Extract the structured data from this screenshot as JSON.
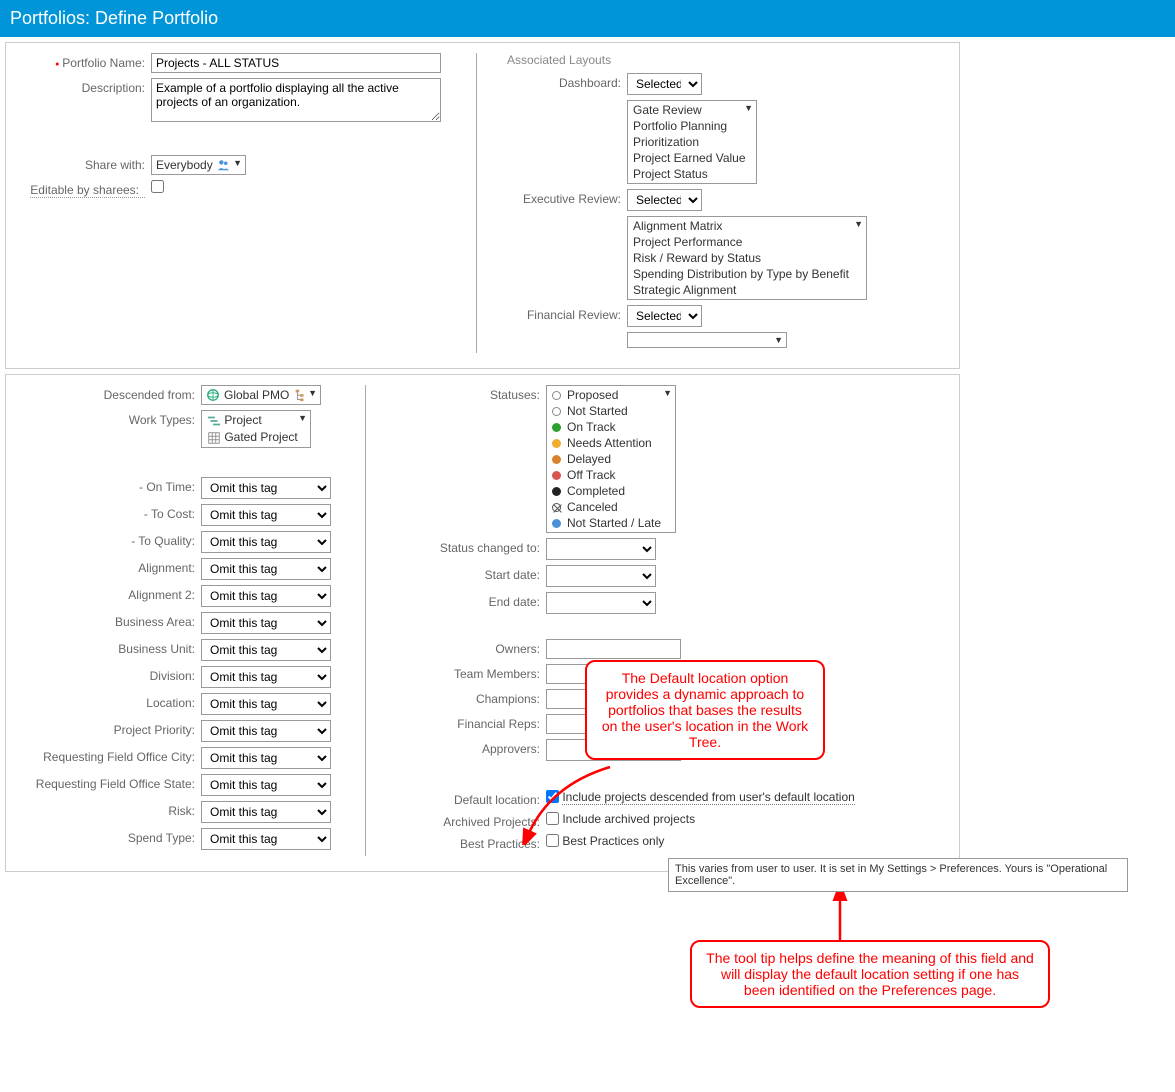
{
  "header": {
    "title": "Portfolios: Define Portfolio"
  },
  "fields": {
    "portfolio_name_label": "Portfolio Name:",
    "portfolio_name": "Projects - ALL STATUS",
    "description_label": "Description:",
    "description": "Example of a portfolio displaying all the active projects of an organization.",
    "share_with_label": "Share with:",
    "share_with": "Everybody",
    "editable_label": "Editable by sharees:"
  },
  "assoc": {
    "title": "Associated Layouts",
    "dashboard_label": "Dashboard:",
    "dashboard_sel": "Selected",
    "dashboard_items": [
      "Gate Review",
      "Portfolio Planning",
      "Prioritization",
      "Project Earned Value",
      "Project Status"
    ],
    "exec_label": "Executive Review:",
    "exec_sel": "Selected",
    "exec_items": [
      "Alignment Matrix",
      "Project Performance",
      "Risk / Reward by Status",
      "Spending Distribution by Type by Benefit",
      "Strategic Alignment"
    ],
    "fin_label": "Financial Review:",
    "fin_sel": "Selected"
  },
  "filters": {
    "descended_label": "Descended from:",
    "descended_val": "Global PMO",
    "worktypes_label": "Work Types:",
    "worktypes": [
      "Project",
      "Gated Project"
    ],
    "tag_labels": [
      "- On Time:",
      "- To Cost:",
      "- To Quality:",
      "Alignment:",
      "Alignment 2:",
      "Business Area:",
      "Business Unit:",
      "Division:",
      "Location:",
      "Project Priority:",
      "Requesting Field Office City:",
      "Requesting Field Office State:",
      "Risk:",
      "Spend Type:"
    ],
    "tag_value": "Omit this tag"
  },
  "right": {
    "statuses_label": "Statuses:",
    "statuses": [
      {
        "name": "Proposed",
        "style": "ring",
        "color": "#888"
      },
      {
        "name": "Not Started",
        "style": "ring",
        "color": "#888"
      },
      {
        "name": "On Track",
        "style": "dot",
        "color": "#2ca02c"
      },
      {
        "name": "Needs Attention",
        "style": "dot",
        "color": "#f0ad2e"
      },
      {
        "name": "Delayed",
        "style": "dot",
        "color": "#d9822b"
      },
      {
        "name": "Off Track",
        "style": "dot",
        "color": "#d9534f"
      },
      {
        "name": "Completed",
        "style": "dot",
        "color": "#222"
      },
      {
        "name": "Canceled",
        "style": "x",
        "color": "#555"
      },
      {
        "name": "Not Started / Late",
        "style": "dot",
        "color": "#4a90d9"
      }
    ],
    "status_changed_label": "Status changed to:",
    "start_label": "Start date:",
    "end_label": "End date:",
    "owners_label": "Owners:",
    "team_label": "Team Members:",
    "champ_label": "Champions:",
    "fin_label": "Financial Reps:",
    "appr_label": "Approvers:",
    "default_loc_label": "Default location:",
    "default_loc_text": "Include projects descended from user's default location",
    "archived_label": "Archived Projects:",
    "archived_text": "Include archived projects",
    "best_label": "Best Practices:",
    "best_text": "Best Practices only"
  },
  "callouts": {
    "top": "The Default location option provides a dynamic approach to portfolios that bases the results on the user's location in the Work Tree.",
    "bottom": "The tool tip helps define the meaning of this field and will display the default location setting if one has been identified on the Preferences page.",
    "tooltip": "This varies from user to user. It is set in My Settings > Preferences. Yours is \"Operational Excellence\"."
  }
}
